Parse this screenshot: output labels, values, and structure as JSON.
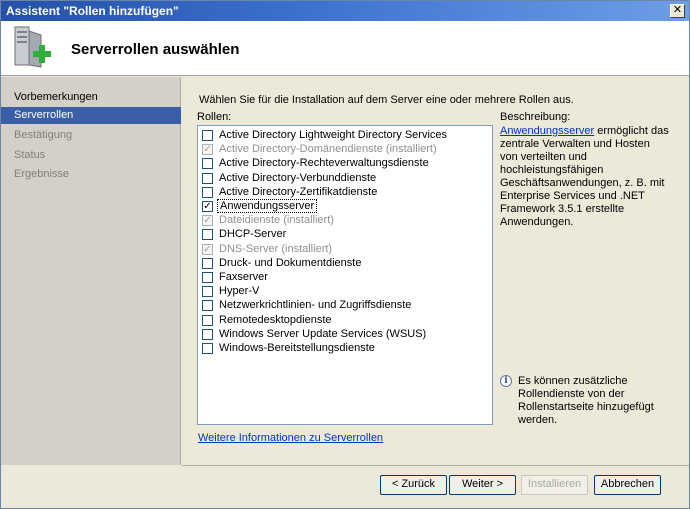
{
  "window": {
    "title": "Assistent \"Rollen hinzufügen\"",
    "close_label": "✕"
  },
  "header": {
    "title": "Serverrollen auswählen",
    "icon": "server-add-icon"
  },
  "sidebar": {
    "items": [
      {
        "label": "Vorbemerkungen",
        "state": "normal"
      },
      {
        "label": "Serverrollen",
        "state": "active"
      },
      {
        "label": "Bestätigung",
        "state": "disabled"
      },
      {
        "label": "Status",
        "state": "disabled"
      },
      {
        "label": "Ergebnisse",
        "state": "disabled"
      }
    ]
  },
  "main": {
    "instruction": "Wählen Sie für die Installation auf dem Server eine oder mehrere Rollen aus.",
    "roles_label": "Rollen:",
    "roles": [
      {
        "label": "Active Directory Lightweight Directory Services",
        "checked": false,
        "disabled": false,
        "selected": false
      },
      {
        "label": "Active Directory-Domänendienste  (installiert)",
        "checked": true,
        "disabled": true,
        "selected": false
      },
      {
        "label": "Active Directory-Rechteverwaltungsdienste",
        "checked": false,
        "disabled": false,
        "selected": false
      },
      {
        "label": "Active Directory-Verbunddienste",
        "checked": false,
        "disabled": false,
        "selected": false
      },
      {
        "label": "Active Directory-Zertifikatdienste",
        "checked": false,
        "disabled": false,
        "selected": false
      },
      {
        "label": "Anwendungsserver",
        "checked": true,
        "disabled": false,
        "selected": true
      },
      {
        "label": "Dateidienste  (installiert)",
        "checked": true,
        "disabled": true,
        "selected": false
      },
      {
        "label": "DHCP-Server",
        "checked": false,
        "disabled": false,
        "selected": false
      },
      {
        "label": "DNS-Server  (installiert)",
        "checked": true,
        "disabled": true,
        "selected": false
      },
      {
        "label": "Druck- und Dokumentdienste",
        "checked": false,
        "disabled": false,
        "selected": false
      },
      {
        "label": "Faxserver",
        "checked": false,
        "disabled": false,
        "selected": false
      },
      {
        "label": "Hyper-V",
        "checked": false,
        "disabled": false,
        "selected": false
      },
      {
        "label": "Netzwerkrichtlinien- und Zugriffsdienste",
        "checked": false,
        "disabled": false,
        "selected": false
      },
      {
        "label": "Remotedesktopdienste",
        "checked": false,
        "disabled": false,
        "selected": false
      },
      {
        "label": "Windows Server Update Services (WSUS)",
        "checked": false,
        "disabled": false,
        "selected": false
      },
      {
        "label": "Windows-Bereitstellungsdienste",
        "checked": false,
        "disabled": false,
        "selected": false
      }
    ],
    "description_label": "Beschreibung:",
    "description_link": "Anwendungsserver",
    "description_text": " ermöglicht das zentrale Verwalten und Hosten von verteilten und hochleistungsfähigen Geschäftsanwendungen, z. B. mit Enterprise Services und .NET Framework 3.5.1 erstellte Anwendungen.",
    "info_text": "Es können zusätzliche Rollendienste von der Rollenstartseite hinzugefügt werden.",
    "more_info_link": "Weitere Informationen zu Serverrollen"
  },
  "footer": {
    "back": "< Zurück",
    "next": "Weiter >",
    "install": "Installieren",
    "cancel": "Abbrechen"
  }
}
